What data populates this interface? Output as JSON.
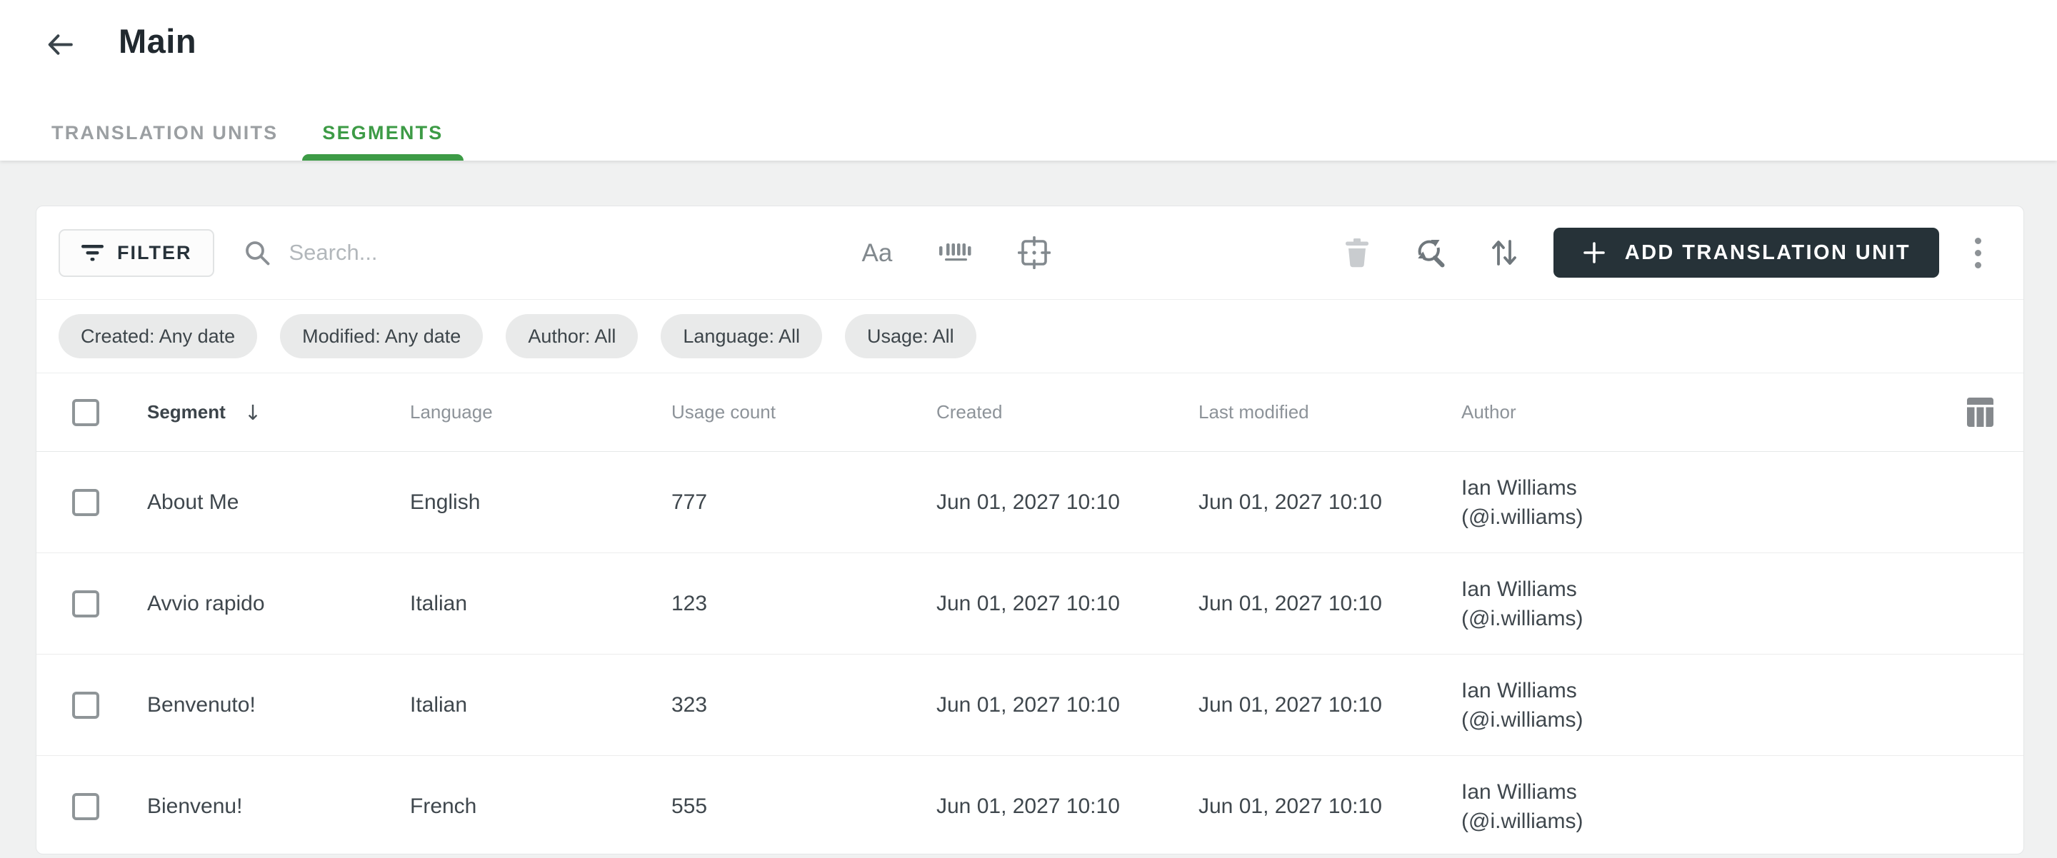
{
  "page": {
    "title": "Main"
  },
  "tabs": {
    "translation_units": "TRANSLATION UNITS",
    "segments": "SEGMENTS"
  },
  "toolbar": {
    "filter_label": "FILTER",
    "search_placeholder": "Search...",
    "match_case_label": "Aa",
    "add_label": "ADD TRANSLATION UNIT"
  },
  "chips": {
    "created": "Created: Any date",
    "modified": "Modified: Any date",
    "author": "Author: All",
    "language": "Language: All",
    "usage": "Usage: All"
  },
  "table": {
    "headers": {
      "segment": "Segment",
      "language": "Language",
      "usage": "Usage count",
      "created": "Created",
      "modified": "Last modified",
      "author": "Author"
    },
    "sort_arrow": "↓",
    "rows": [
      {
        "segment": "About Me",
        "language": "English",
        "usage": "777",
        "created": "Jun 01, 2027 10:10",
        "modified": "Jun 01, 2027 10:10",
        "author_name": "Ian Williams",
        "author_handle": "(@i.williams)"
      },
      {
        "segment": "Avvio rapido",
        "language": "Italian",
        "usage": "123",
        "created": "Jun 01, 2027 10:10",
        "modified": "Jun 01, 2027 10:10",
        "author_name": "Ian Williams",
        "author_handle": "(@i.williams)"
      },
      {
        "segment": "Benvenuto!",
        "language": "Italian",
        "usage": "323",
        "created": "Jun 01, 2027 10:10",
        "modified": "Jun 01, 2027 10:10",
        "author_name": "Ian Williams",
        "author_handle": "(@i.williams)"
      },
      {
        "segment": "Bienvenu!",
        "language": "French",
        "usage": "555",
        "created": "Jun 01, 2027 10:10",
        "modified": "Jun 01, 2027 10:10",
        "author_name": "Ian Williams",
        "author_handle": "(@i.williams)"
      }
    ]
  },
  "colors": {
    "accent_green": "#3d9b46",
    "dark_button": "#263238",
    "page_background": "#f0f1f1"
  }
}
